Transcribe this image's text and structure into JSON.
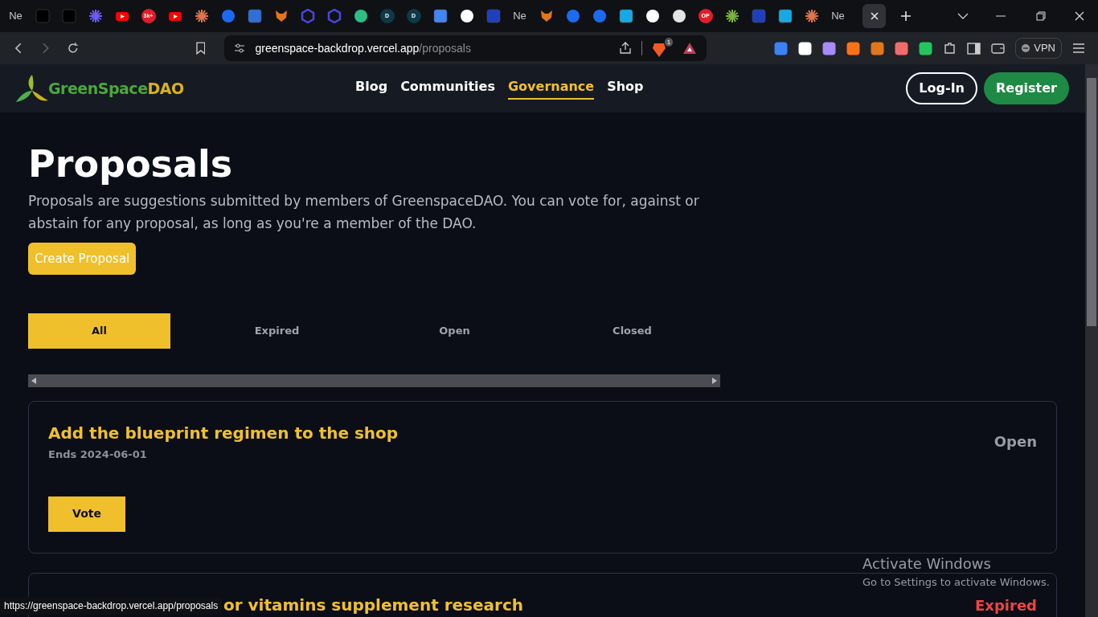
{
  "browser": {
    "tabs": [
      {
        "kind": "text",
        "label": "Ne",
        "selected": false
      },
      {
        "kind": "capcut",
        "selected": false
      },
      {
        "kind": "capcut",
        "selected": false
      },
      {
        "kind": "asterisk",
        "selected": false
      },
      {
        "kind": "youtube",
        "selected": false
      },
      {
        "kind": "badge",
        "label": "3k+",
        "selected": false
      },
      {
        "kind": "youtube",
        "selected": false
      },
      {
        "kind": "starburst",
        "selected": false
      },
      {
        "kind": "bluedot",
        "selected": false
      },
      {
        "kind": "doc",
        "selected": false
      },
      {
        "kind": "fox",
        "selected": false
      },
      {
        "kind": "hexagon",
        "selected": false
      },
      {
        "kind": "hexagon",
        "selected": false
      },
      {
        "kind": "chain",
        "selected": false
      },
      {
        "kind": "letter",
        "label": "D",
        "selected": false
      },
      {
        "kind": "letter",
        "label": "D",
        "selected": false
      },
      {
        "kind": "docs",
        "selected": false
      },
      {
        "kind": "github",
        "selected": false
      },
      {
        "kind": "triangle",
        "selected": false
      },
      {
        "kind": "text",
        "label": "Ne",
        "selected": false
      },
      {
        "kind": "fox",
        "selected": false
      },
      {
        "kind": "bluedot",
        "selected": false
      },
      {
        "kind": "bluedot",
        "selected": false
      },
      {
        "kind": "vimeo",
        "selected": false
      },
      {
        "kind": "github",
        "selected": false
      },
      {
        "kind": "owl",
        "selected": false
      },
      {
        "kind": "badge",
        "label": "OP",
        "selected": false
      },
      {
        "kind": "triad",
        "selected": false
      },
      {
        "kind": "triangle",
        "selected": false
      },
      {
        "kind": "vimeo",
        "selected": false
      },
      {
        "kind": "starburst",
        "selected": false
      },
      {
        "kind": "text",
        "label": "Ne",
        "selected": false
      },
      {
        "kind": "close",
        "selected": true
      }
    ],
    "address": {
      "host": "greenspace-backdrop.vercel.app",
      "path": "/proposals"
    },
    "shield_count": "1",
    "vpn": "VPN",
    "status_url": "https://greenspace-backdrop.vercel.app/proposals"
  },
  "site": {
    "logo_green": "GreenSpace",
    "logo_gold": "DAO",
    "nav": [
      {
        "label": "Blog",
        "selected": false
      },
      {
        "label": "Communities",
        "selected": false
      },
      {
        "label": "Governance",
        "selected": true
      },
      {
        "label": "Shop",
        "selected": false
      }
    ],
    "login": "Log-In",
    "register": "Register"
  },
  "page": {
    "title": "Proposals",
    "description": "Proposals are suggestions submitted by members of GreenspaceDAO. You can vote for, against or abstain for any proposal, as long as you're a member of the DAO.",
    "create_button": "Create Proposal",
    "filters": [
      {
        "label": "All",
        "selected": true
      },
      {
        "label": "Expired",
        "selected": false
      },
      {
        "label": "Open",
        "selected": false
      },
      {
        "label": "Closed",
        "selected": false
      }
    ],
    "proposals": [
      {
        "title": "Add the blueprint regimen to the shop",
        "ends": "Ends 2024-06-01",
        "status": "Open",
        "kind": "open",
        "vote": "Vote"
      },
      {
        "title": "or vitamins supplement research",
        "status": "Expired",
        "kind": "expired"
      }
    ]
  },
  "os_notice": {
    "title": "Activate Windows",
    "subtitle": "Go to Settings to activate Windows."
  }
}
